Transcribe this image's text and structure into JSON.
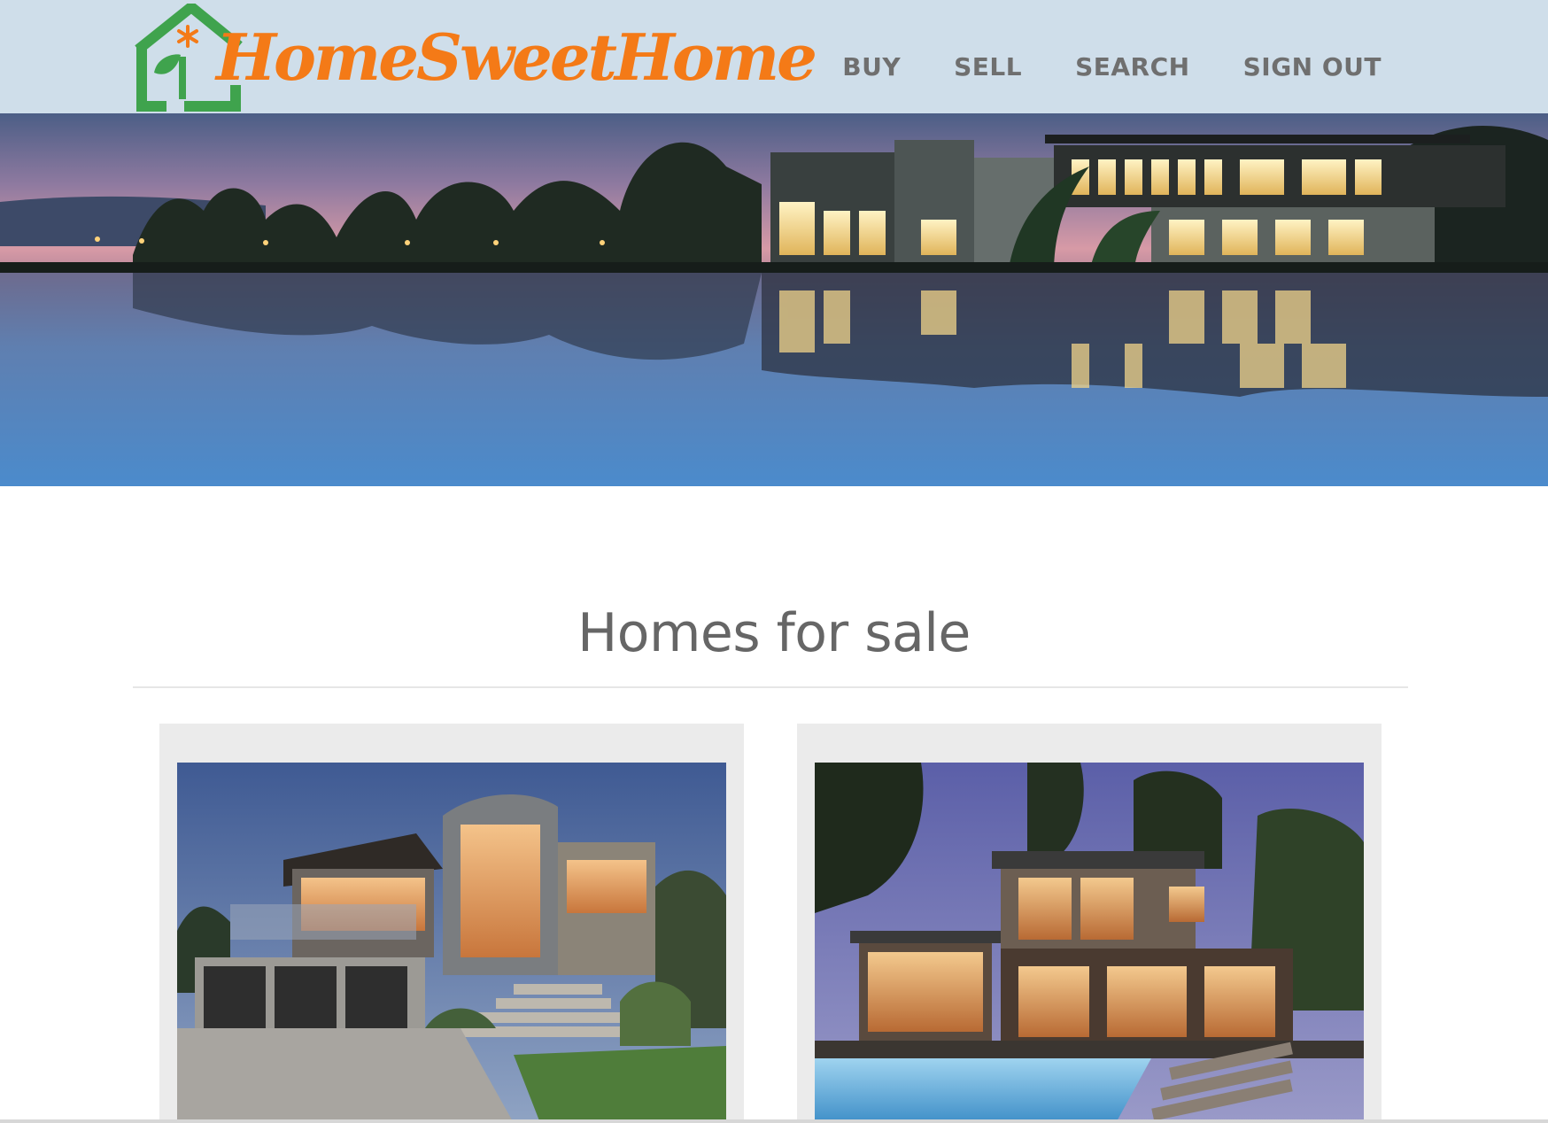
{
  "brand": {
    "name": "HomeSweetHome",
    "colors": {
      "orange": "#f47a17",
      "green": "#3fa34d",
      "header_bg": "#cfdeea",
      "nav_text": "#6f6f6f"
    },
    "icon": "house-flower-leaf-icon"
  },
  "nav": {
    "items": [
      {
        "label": "BUY"
      },
      {
        "label": "SELL"
      },
      {
        "label": "SEARCH"
      },
      {
        "label": "SIGN OUT"
      }
    ]
  },
  "hero": {
    "image": "lakeside-modern-house-at-dusk"
  },
  "section": {
    "title": "Homes for sale"
  },
  "listings": [
    {
      "image": "modern-hillside-house-with-garage"
    },
    {
      "image": "modern-house-with-pool-at-night"
    }
  ]
}
